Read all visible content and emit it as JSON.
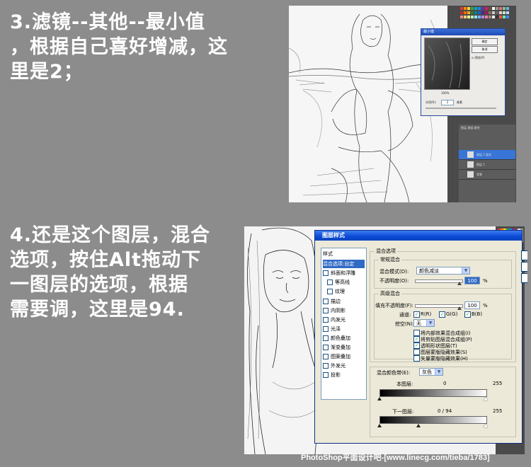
{
  "captions": {
    "step3": [
      "3.滤镜--其他--最小值",
      "，根据自己喜好增减，这",
      "里是2；"
    ],
    "step4": [
      "4.还是这个图层，混合",
      "选项，按住Alt拖动下",
      "一图层的选项，根据",
      "需要调，这里是94."
    ]
  },
  "min_dialog": {
    "title": "最小值",
    "ok_label": "确定",
    "cancel_label": "取消",
    "preview_label": "预览(P)",
    "zoom": "100%",
    "radius_label": "半径(R):",
    "radius_value": "2",
    "unit": "像素"
  },
  "layers_panel": {
    "tabs": "图层  通道  路径",
    "rows": [
      "图层 1 副本",
      "图层 1",
      "背景"
    ]
  },
  "layer_style": {
    "title": "图层样式",
    "styles_header": "样式",
    "list": [
      {
        "label": "混合选项:自定",
        "selected": true,
        "checkbox": false
      },
      {
        "label": "斜面和浮雕",
        "checkbox": true
      },
      {
        "label": "等高线",
        "checkbox": true,
        "indent": true
      },
      {
        "label": "纹理",
        "checkbox": true,
        "indent": true
      },
      {
        "label": "描边",
        "checkbox": true
      },
      {
        "label": "内阴影",
        "checkbox": true
      },
      {
        "label": "内发光",
        "checkbox": true
      },
      {
        "label": "光泽",
        "checkbox": true
      },
      {
        "label": "颜色叠加",
        "checkbox": true
      },
      {
        "label": "渐变叠加",
        "checkbox": true
      },
      {
        "label": "图案叠加",
        "checkbox": true
      },
      {
        "label": "外发光",
        "checkbox": true
      },
      {
        "label": "投影",
        "checkbox": true
      }
    ],
    "blend_options_legend": "混合选项",
    "general_legend": "常规混合",
    "blend_mode_label": "混合模式(D):",
    "blend_mode_value": "颜色减淡",
    "opacity_label": "不透明度(O):",
    "opacity_value": "100",
    "percent": "%",
    "advanced_legend": "高级混合",
    "fill_label": "填充不透明度(F):",
    "fill_value": "100",
    "channels_label": "通道:",
    "channel_r": "R(R)",
    "channel_g": "G(G)",
    "channel_b": "B(B)",
    "knockout_label": "挖空(N):",
    "knockout_value": "无",
    "options": [
      {
        "label": "将内部效果混合成组(I)",
        "checked": false
      },
      {
        "label": "将剪贴图层混合成组(P)",
        "checked": true
      },
      {
        "label": "透明形状图层(T)",
        "checked": true
      },
      {
        "label": "图层蒙版隐藏效果(S)",
        "checked": false
      },
      {
        "label": "矢量蒙版隐藏效果(H)",
        "checked": false
      }
    ],
    "blend_if_label": "混合颜色带(E):",
    "blend_if_value": "灰色",
    "this_layer_label": "本图层:",
    "this_layer_low": "0",
    "this_layer_high": "255",
    "under_layer_label": "下一图层:",
    "under_layer_low": "0 / 94",
    "under_layer_high": "255"
  },
  "watermark": "PhotoShop平面设计吧-[www.linecg.com/tieba/1783]"
}
